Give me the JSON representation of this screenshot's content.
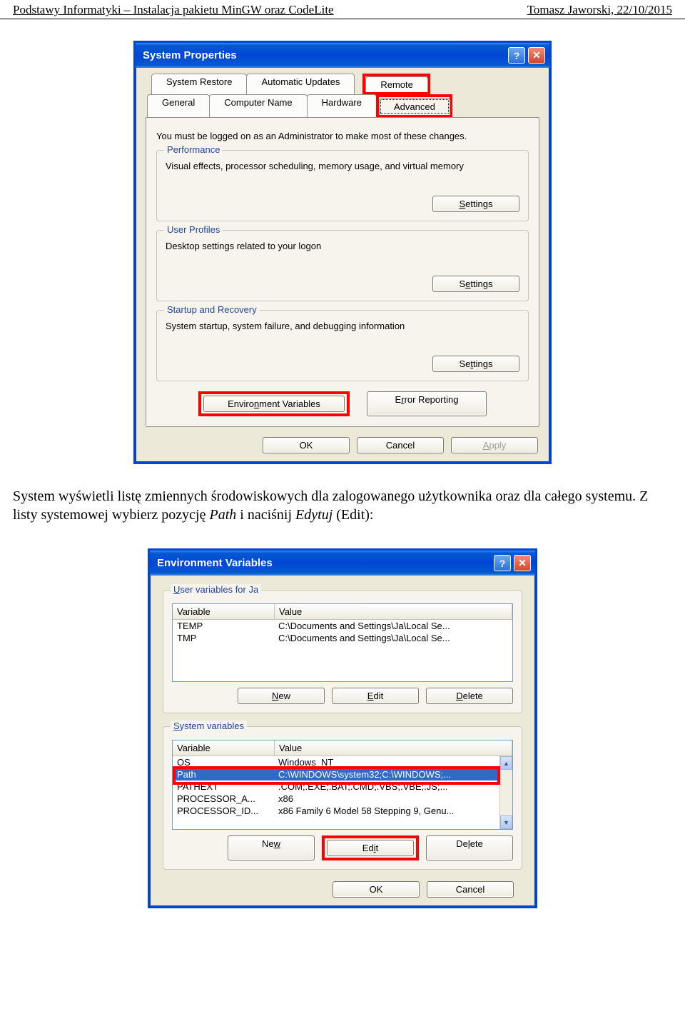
{
  "header": {
    "left": "Podstawy Informatyki – Instalacja pakietu MinGW oraz CodeLite",
    "right": "Tomasz Jaworski, 22/10/2015"
  },
  "sysprops": {
    "title": "System Properties",
    "tabs_row1": [
      {
        "key": "restore",
        "label": "System Restore"
      },
      {
        "key": "updates",
        "label": "Automatic Updates"
      },
      {
        "key": "remote",
        "label": "Remote"
      }
    ],
    "tabs_row2": [
      {
        "key": "general",
        "label": "General"
      },
      {
        "key": "compname",
        "label": "Computer Name"
      },
      {
        "key": "hardware",
        "label": "Hardware"
      },
      {
        "key": "advanced",
        "label": "Advanced"
      }
    ],
    "intro": "You must be logged on as an Administrator to make most of these changes.",
    "perf": {
      "title": "Performance",
      "desc": "Visual effects, processor scheduling, memory usage, and virtual memory",
      "btn": "Settings"
    },
    "profiles": {
      "title": "User Profiles",
      "desc": "Desktop settings related to your logon",
      "btn": "Settings"
    },
    "startup": {
      "title": "Startup and Recovery",
      "desc": "System startup, system failure, and debugging information",
      "btn": "Settings"
    },
    "envvars_btn": "Environment Variables",
    "errrep_btn": "Error Reporting",
    "ok": "OK",
    "cancel": "Cancel",
    "apply": "Apply"
  },
  "paragraph": {
    "text_before": "System wyświetli listę zmiennych środowiskowych dla zalogowanego użytkownika oraz dla całego systemu. Z listy systemowej wybierz pozycję ",
    "path_word": "Path",
    "text_mid": " i naciśnij ",
    "edit_word": "Edytuj",
    "edit_paren": " (Edit):"
  },
  "envdlg": {
    "title": "Environment Variables",
    "user_group": "User variables for Ja",
    "sys_group": "System variables",
    "col_var": "Variable",
    "col_val": "Value",
    "user_rows": [
      {
        "var": "TEMP",
        "val": "C:\\Documents and Settings\\Ja\\Local Se..."
      },
      {
        "var": "TMP",
        "val": "C:\\Documents and Settings\\Ja\\Local Se..."
      }
    ],
    "sys_rows": [
      {
        "var": "OS",
        "val": "Windows_NT"
      },
      {
        "var": "Path",
        "val": "C:\\WINDOWS\\system32;C:\\WINDOWS;..."
      },
      {
        "var": "PATHEXT",
        "val": ".COM;.EXE;.BAT;.CMD;.VBS;.VBE;.JS;..."
      },
      {
        "var": "PROCESSOR_A...",
        "val": "x86"
      },
      {
        "var": "PROCESSOR_ID...",
        "val": "x86 Family 6 Model 58 Stepping 9, Genu..."
      }
    ],
    "btn_new": "New",
    "btn_edit": "Edit",
    "btn_delete": "Delete",
    "ok": "OK",
    "cancel": "Cancel"
  }
}
